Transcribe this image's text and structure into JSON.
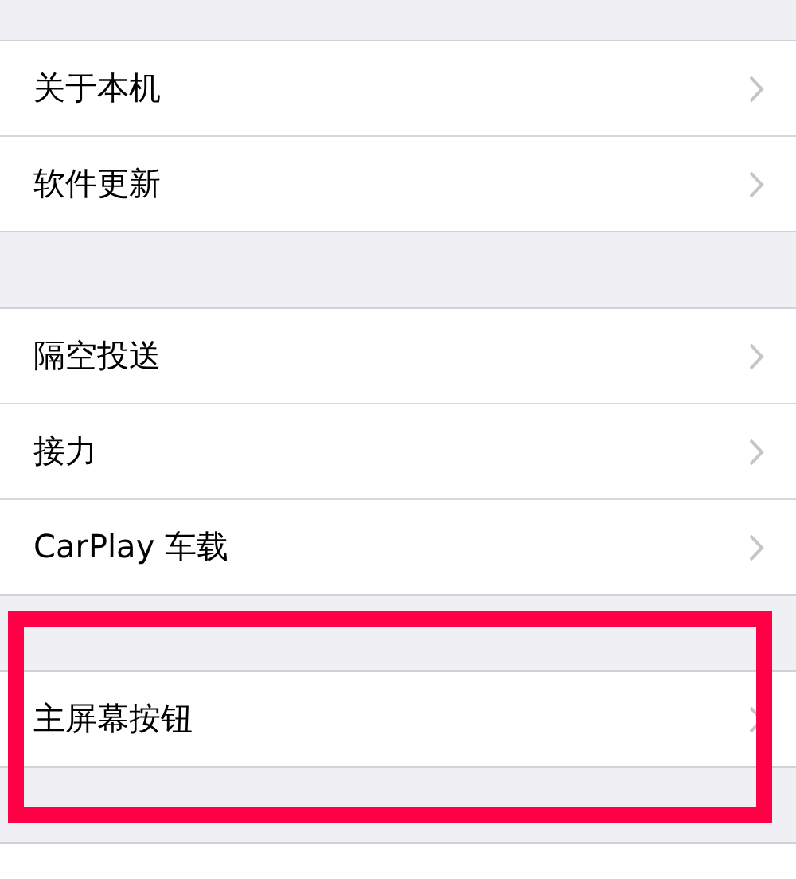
{
  "groups": [
    {
      "highlighted": false,
      "items": [
        {
          "label": "关于本机"
        },
        {
          "label": "软件更新"
        }
      ]
    },
    {
      "highlighted": false,
      "items": [
        {
          "label": "隔空投送"
        },
        {
          "label": "接力"
        },
        {
          "label": "CarPlay 车载"
        }
      ]
    },
    {
      "highlighted": true,
      "items": [
        {
          "label": "主屏幕按钮"
        }
      ]
    }
  ]
}
